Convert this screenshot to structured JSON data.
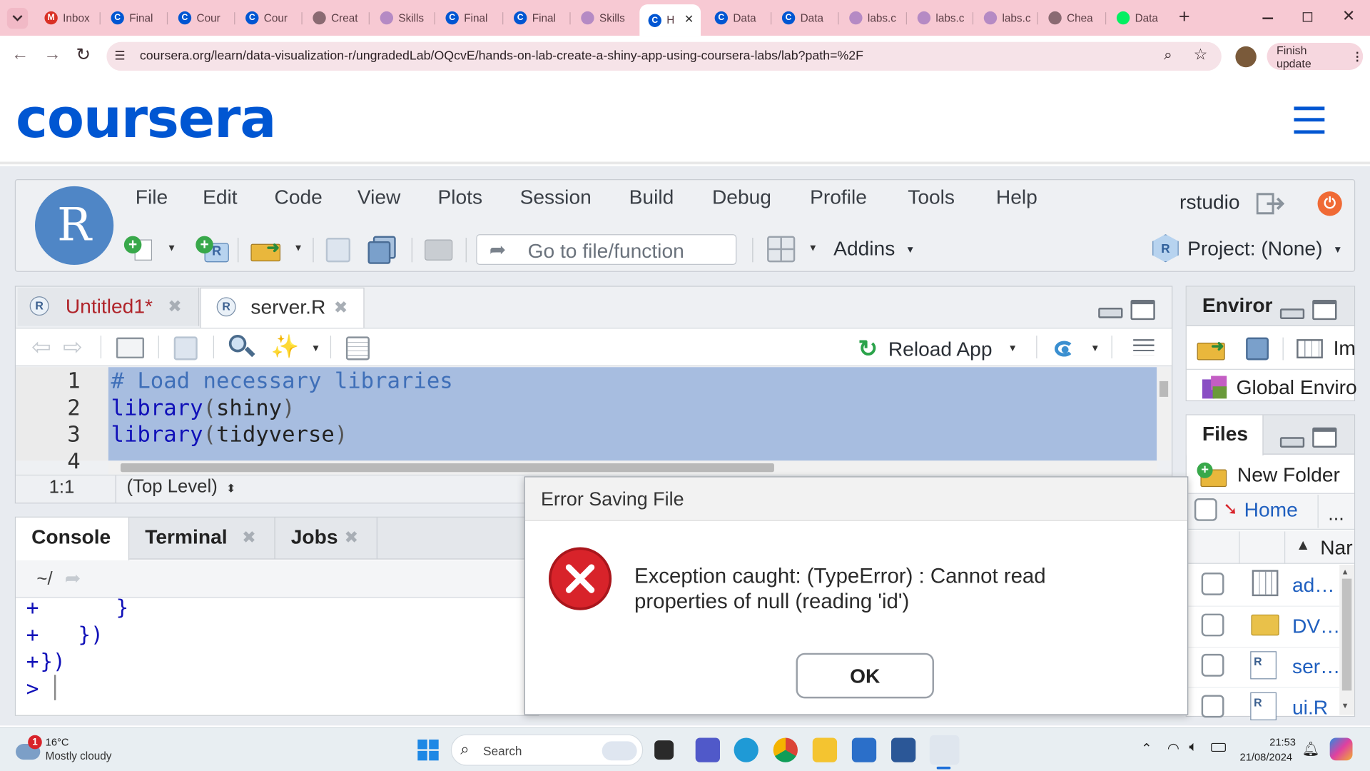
{
  "browser": {
    "tabs": [
      {
        "label": "Inbox",
        "icon": "gmail-icon",
        "color": "#d93025"
      },
      {
        "label": "Final",
        "icon": "coursera-icon",
        "color": "#0056d2"
      },
      {
        "label": "Cour",
        "icon": "coursera-icon",
        "color": "#0056d2"
      },
      {
        "label": "Cour",
        "icon": "coursera-icon",
        "color": "#0056d2"
      },
      {
        "label": "Creat",
        "icon": "globe-icon",
        "color": "#8a6a72"
      },
      {
        "label": "Skills",
        "icon": "lab-icon",
        "color": "#b58ac4"
      },
      {
        "label": "Final",
        "icon": "coursera-icon",
        "color": "#0056d2"
      },
      {
        "label": "Final",
        "icon": "coursera-icon",
        "color": "#0056d2"
      },
      {
        "label": "Skills",
        "icon": "lab-icon",
        "color": "#b58ac4"
      },
      {
        "label": "H",
        "icon": "coursera-icon",
        "color": "#0056d2"
      },
      {
        "label": "Data",
        "icon": "coursera-icon",
        "color": "#0056d2"
      },
      {
        "label": "Data",
        "icon": "coursera-icon",
        "color": "#0056d2"
      },
      {
        "label": "labs.c",
        "icon": "lab-icon",
        "color": "#b58ac4"
      },
      {
        "label": "labs.c",
        "icon": "lab-icon",
        "color": "#b58ac4"
      },
      {
        "label": "labs.c",
        "icon": "lab-icon",
        "color": "#b58ac4"
      },
      {
        "label": "Chea",
        "icon": "globe-icon",
        "color": "#8a6a72"
      },
      {
        "label": "Data",
        "icon": "datacamp-icon",
        "color": "#03ef62"
      }
    ],
    "new_tab": "+",
    "url": "coursera.org/learn/data-visualization-r/ungradedLab/OQcvE/hands-on-lab-create-a-shiny-app-using-coursera-labs/lab?path=%2F",
    "finish_update": "Finish update"
  },
  "coursera": {
    "logo": "coursera"
  },
  "rstudio": {
    "logo_letter": "R",
    "menu": [
      "File",
      "Edit",
      "Code",
      "View",
      "Plots",
      "Session",
      "Build",
      "Debug",
      "Profile",
      "Tools",
      "Help"
    ],
    "user": "rstudio",
    "goto_placeholder": "Go to file/function",
    "addins": "Addins",
    "project": "Project: (None)",
    "editor": {
      "tabs": [
        {
          "label": "Untitled1*",
          "color": "#b0242a"
        },
        {
          "label": "server.R",
          "color": "#333"
        }
      ],
      "reload_app": "Reload App",
      "line_numbers": [
        "1",
        "2",
        "3",
        "4"
      ],
      "lines": [
        [
          {
            "t": "# Load necessary libraries",
            "c": "#3f6fb8"
          }
        ],
        [
          {
            "t": "library",
            "c": "#1010b8"
          },
          {
            "t": "(",
            "c": "#555"
          },
          {
            "t": "shiny",
            "c": "#222"
          },
          {
            "t": ")",
            "c": "#555"
          }
        ],
        [
          {
            "t": "library",
            "c": "#1010b8"
          },
          {
            "t": "(",
            "c": "#555"
          },
          {
            "t": "tidyverse",
            "c": "#222"
          },
          {
            "t": ")",
            "c": "#555"
          }
        ],
        []
      ],
      "position": "1:1",
      "scope": "(Top Level)"
    },
    "console": {
      "tabs": [
        "Console",
        "Terminal",
        "Jobs"
      ],
      "path": "~/",
      "lines": [
        {
          "prompt": "+",
          "text": "      }"
        },
        {
          "prompt": "+",
          "text": "   })"
        },
        {
          "prompt": "+",
          "text": "})"
        },
        {
          "prompt": ">",
          "text": ""
        }
      ]
    },
    "environment": {
      "tab": "Enviror",
      "import": "Im",
      "global": "Global Enviro"
    },
    "files": {
      "tab": "Files",
      "new_folder": "New Folder",
      "home": "Home",
      "more": "...",
      "name_col": "Nar",
      "rows": [
        {
          "name": "ad…",
          "icon": "table-icon"
        },
        {
          "name": "DV…",
          "icon": "folder-icon"
        },
        {
          "name": "ser…",
          "icon": "r-file-icon"
        },
        {
          "name": "ui.R",
          "icon": "r-file-icon"
        }
      ]
    }
  },
  "dialog": {
    "title": "Error Saving File",
    "message_line1": "Exception caught: (TypeError) : Cannot read",
    "message_line2": "properties of null (reading 'id')",
    "ok": "OK",
    "error_color": "#d8232a"
  },
  "taskbar": {
    "weather_badge": "1",
    "temperature": "16°C",
    "condition": "Mostly cloudy",
    "search": "Search",
    "time": "21:53",
    "date": "21/08/2024"
  }
}
